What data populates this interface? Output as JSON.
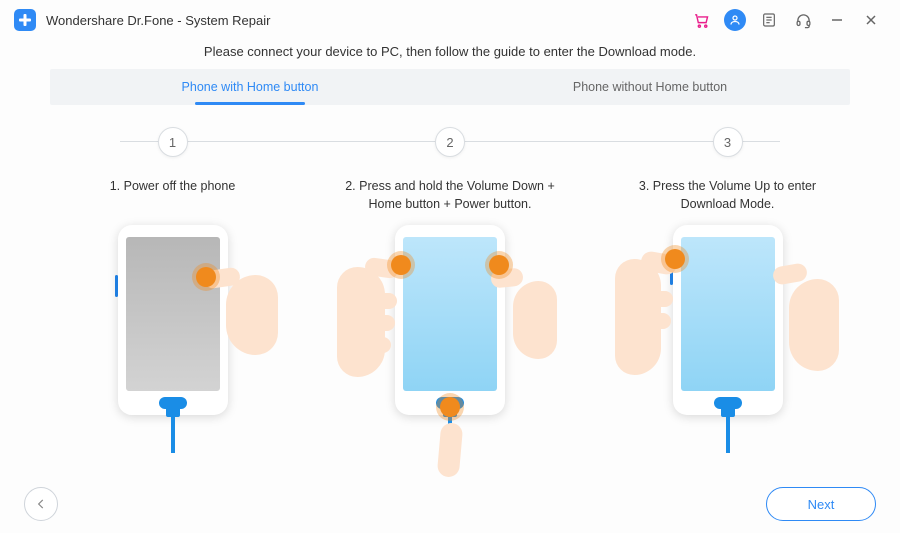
{
  "window": {
    "title": "Wondershare Dr.Fone - System Repair"
  },
  "titlebar_icons": {
    "cart": "cart",
    "user": "user",
    "feedback": "feedback",
    "headset": "support",
    "minimize": "minimize",
    "close": "close"
  },
  "instruction": "Please connect your device to PC, then follow the guide to enter the Download mode.",
  "tabs": {
    "with_home": "Phone with Home button",
    "without_home": "Phone without Home button",
    "active": "with_home"
  },
  "steps": {
    "s1": {
      "num": "1",
      "caption": "1. Power off the phone"
    },
    "s2": {
      "num": "2",
      "caption": "2. Press and hold the Volume Down + Home button + Power button."
    },
    "s3": {
      "num": "3",
      "caption": "3. Press the Volume Up to enter Download Mode."
    }
  },
  "footer": {
    "next": "Next"
  }
}
